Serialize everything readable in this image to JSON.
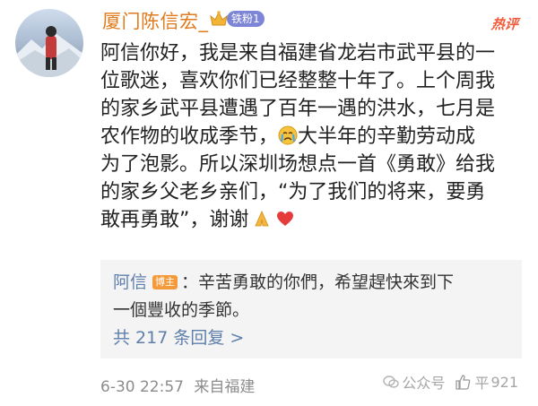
{
  "post": {
    "username": "厦门陈信宏_",
    "fan_badge": "铁粉1",
    "hot_label": "热评",
    "lines": [
      "阿信你好，我是来自福建省龙岩市武平县的一",
      "位歌迷，喜欢你们已经整整十年了。上个周我",
      "的家乡武平县遭遇了百年一遇的洪水，七月是",
      {
        "before": "农作物的收成季节，",
        "after": "大半年的辛勤劳动成"
      },
      "为了泡影。所以深圳场想点一首《勇敢》给我",
      "的家乡父老乡亲们，“为了我们的将来，要勇",
      "敢再勇敢”，谢谢"
    ],
    "line4_before": "农作物的收成季节，",
    "line4_after": "大半年的辛勤劳动成",
    "icons": [
      "crown-icon",
      "crying-emoji",
      "pray-emoji",
      "heart-emoji"
    ]
  },
  "reply": {
    "author": "阿信",
    "author_badge": "博主",
    "line1": "：辛苦勇敢的你們，希望趕快來到下",
    "line2": "一個豐收的季節。",
    "count_label": "共 217 条回复 >"
  },
  "footer": {
    "time": "6-30 22:57",
    "location": "来自福建",
    "watermark1": "公众号",
    "watermark2": "平",
    "like_count": "921"
  },
  "colors": {
    "username": "#e07a1c",
    "link": "#5e7fab",
    "hot": "#f25a3a",
    "badge": "#7d86d6"
  }
}
